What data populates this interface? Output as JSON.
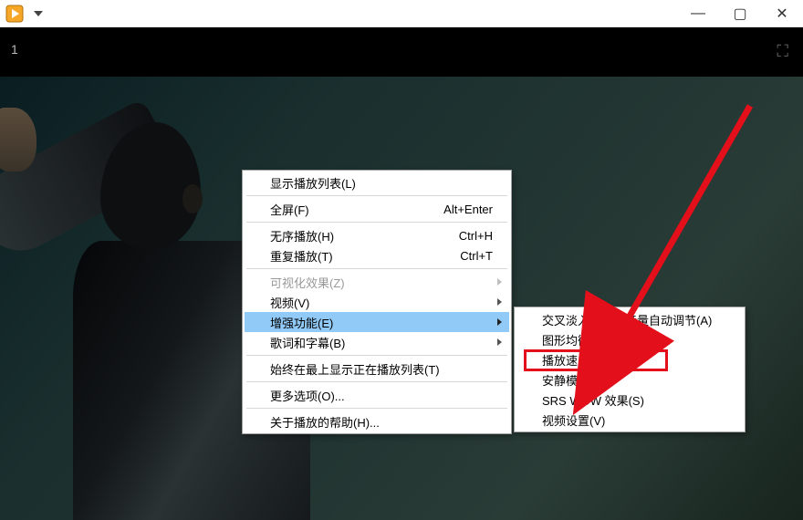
{
  "titlebar": {
    "minimize": "—",
    "maximize": "▢",
    "close": "✕"
  },
  "video": {
    "index": "1",
    "expand_icon": "⛶"
  },
  "menu": [
    {
      "type": "item",
      "label": "显示播放列表(L)",
      "shortcut": ""
    },
    {
      "type": "sep"
    },
    {
      "type": "item",
      "label": "全屏(F)",
      "shortcut": "Alt+Enter"
    },
    {
      "type": "sep"
    },
    {
      "type": "item",
      "label": "无序播放(H)",
      "shortcut": "Ctrl+H"
    },
    {
      "type": "item",
      "label": "重复播放(T)",
      "shortcut": "Ctrl+T"
    },
    {
      "type": "sep"
    },
    {
      "type": "item",
      "label": "可视化效果(Z)",
      "shortcut": "",
      "sub": true,
      "disabled": true
    },
    {
      "type": "item",
      "label": "视频(V)",
      "shortcut": "",
      "sub": true
    },
    {
      "type": "item",
      "label": "增强功能(E)",
      "shortcut": "",
      "sub": true,
      "selected": true
    },
    {
      "type": "item",
      "label": "歌词和字幕(B)",
      "shortcut": "",
      "sub": true
    },
    {
      "type": "sep"
    },
    {
      "type": "item",
      "label": "始终在最上显示正在播放列表(T)",
      "shortcut": ""
    },
    {
      "type": "sep"
    },
    {
      "type": "item",
      "label": "更多选项(O)...",
      "shortcut": ""
    },
    {
      "type": "sep"
    },
    {
      "type": "item",
      "label": "关于播放的帮助(H)...",
      "shortcut": ""
    }
  ],
  "submenu": [
    {
      "label": "交叉淡入淡出和音量自动调节(A)"
    },
    {
      "label": "图形均衡器(G)"
    },
    {
      "label": "播放速度设置(L)"
    },
    {
      "label": "安静模式(Q)"
    },
    {
      "label": "SRS WOW 效果(S)"
    },
    {
      "label": "视频设置(V)"
    }
  ]
}
